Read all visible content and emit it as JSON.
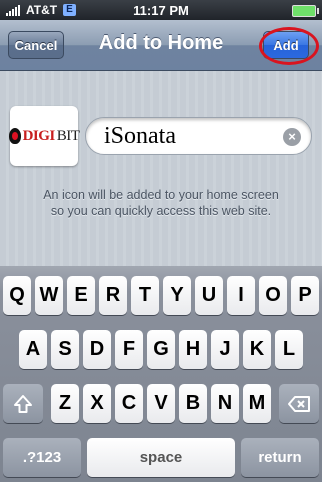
{
  "status_bar": {
    "carrier": "AT&T",
    "network": "E",
    "time": "11:17 PM"
  },
  "nav": {
    "cancel_label": "Cancel",
    "title": "Add to Home",
    "add_label": "Add"
  },
  "bookmark": {
    "icon_logo_text": "DIGIBIT",
    "name_value": "iSonata",
    "hint_line1": "An icon will be added to your home screen",
    "hint_line2": "so you can quickly access this web site."
  },
  "keyboard": {
    "row1": [
      "Q",
      "W",
      "E",
      "R",
      "T",
      "Y",
      "U",
      "I",
      "O",
      "P"
    ],
    "row2": [
      "A",
      "S",
      "D",
      "F",
      "G",
      "H",
      "J",
      "K",
      "L"
    ],
    "row3": [
      "Z",
      "X",
      "C",
      "V",
      "B",
      "N",
      "M"
    ],
    "shift_icon": "shift-arrow-icon",
    "delete_icon": "backspace-icon",
    "numbers_label": ".?123",
    "space_label": "space",
    "return_label": "return"
  },
  "colors": {
    "add_highlight": "#d9141f",
    "nav_bar": "#7a8ca6"
  }
}
